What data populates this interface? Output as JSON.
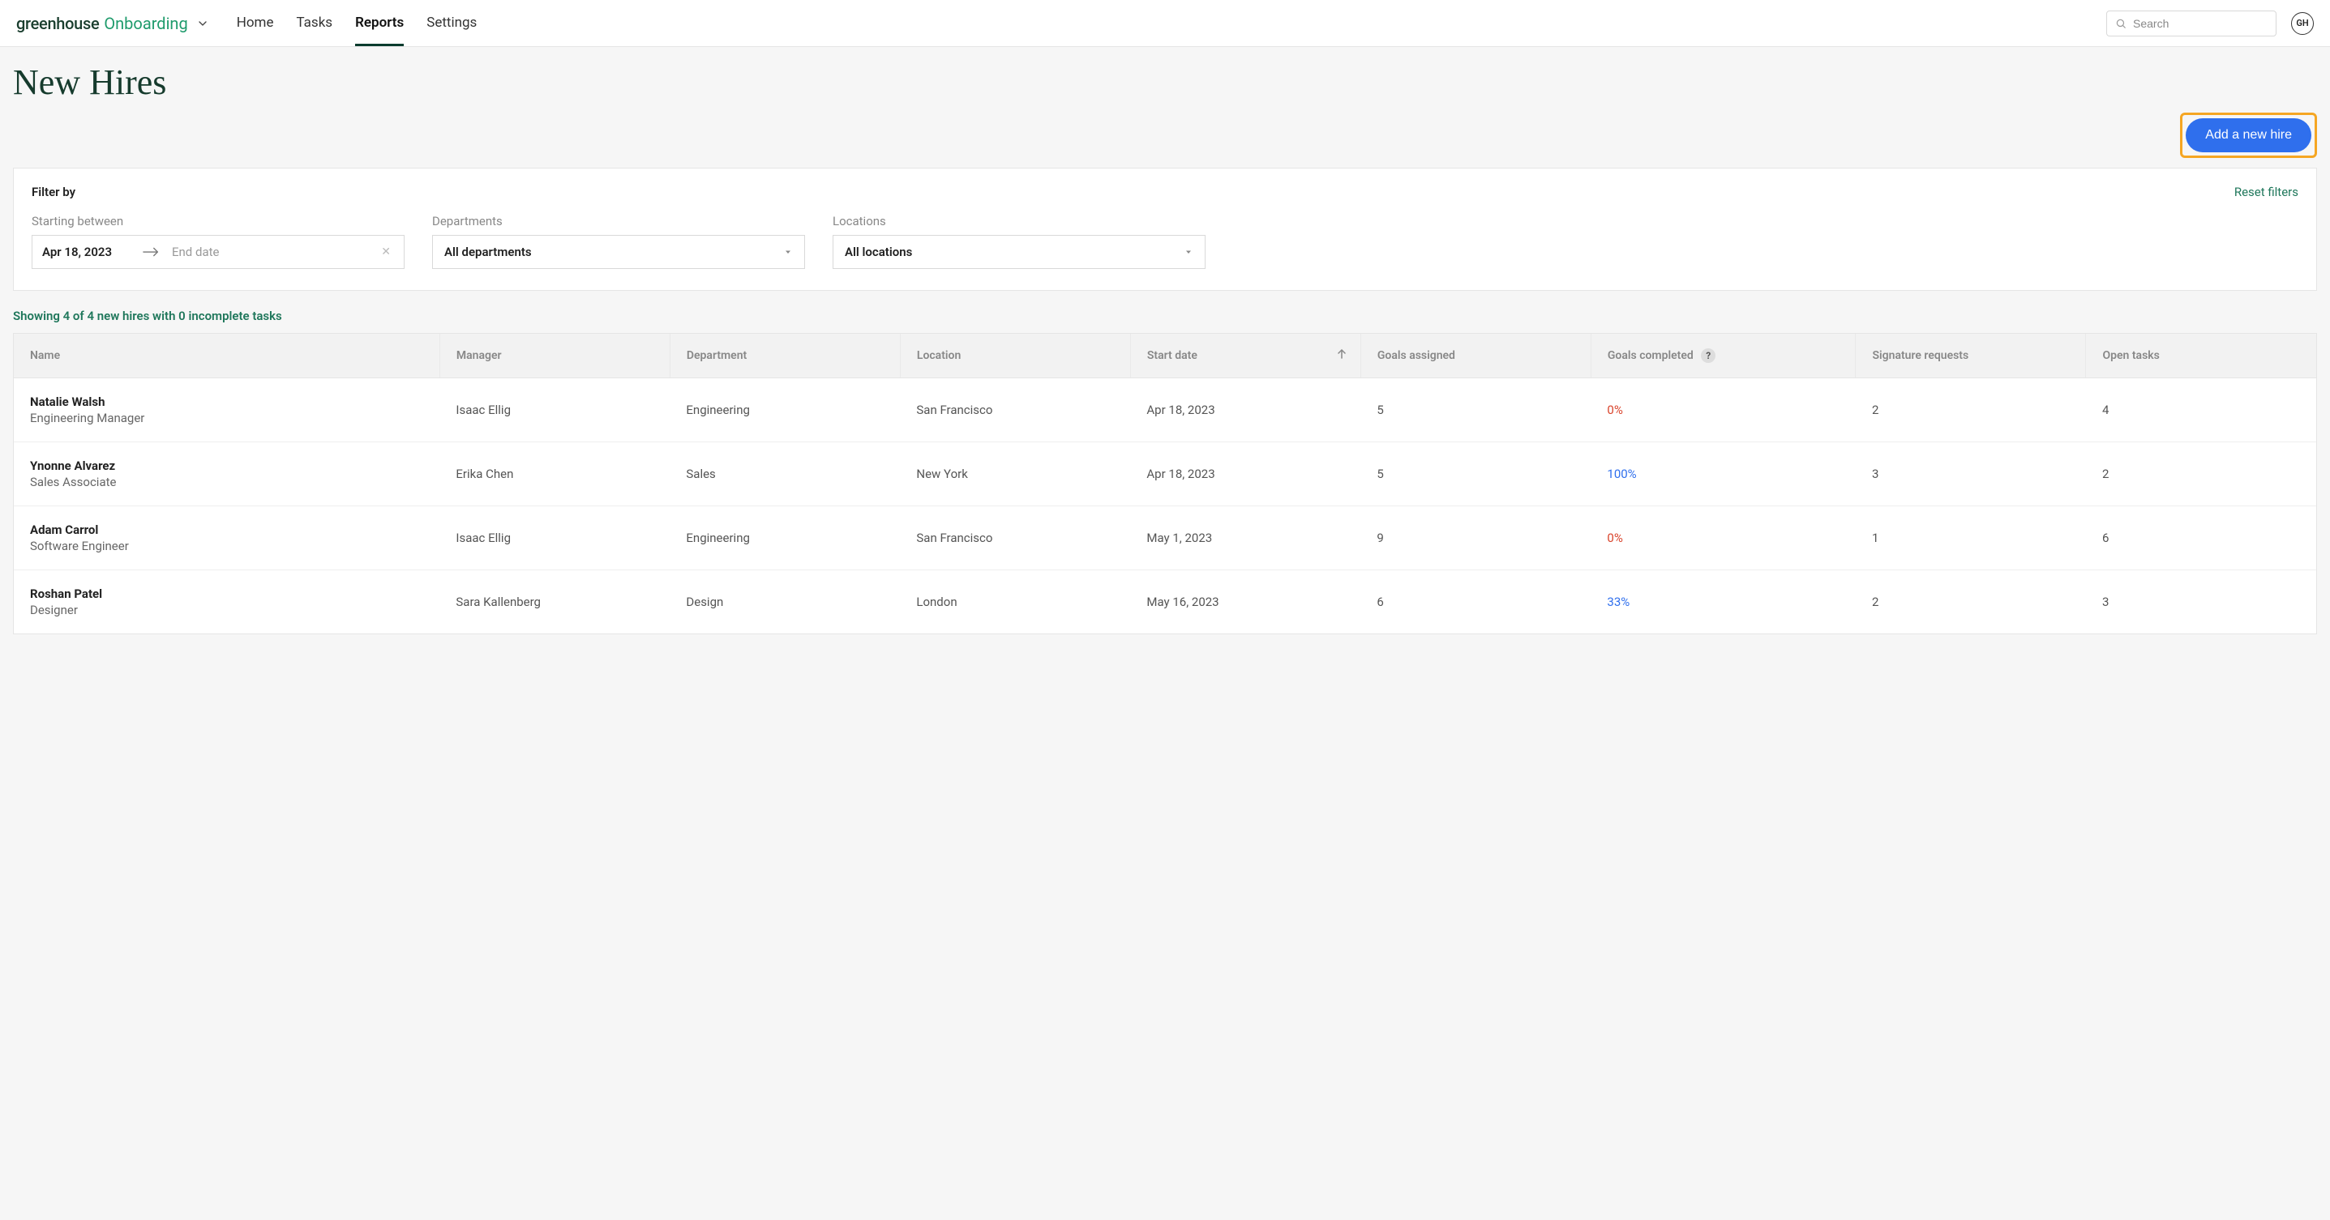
{
  "brand": {
    "main": "greenhouse",
    "sub": "Onboarding"
  },
  "nav": {
    "home": "Home",
    "tasks": "Tasks",
    "reports": "Reports",
    "settings": "Settings"
  },
  "search": {
    "placeholder": "Search"
  },
  "avatar": {
    "initials": "GH"
  },
  "page_title": "New Hires",
  "actions": {
    "add_new_hire": "Add a new hire"
  },
  "filter": {
    "label": "Filter by",
    "reset": "Reset filters",
    "starting_between_label": "Starting between",
    "start_date": "Apr 18, 2023",
    "end_date_placeholder": "End date",
    "departments_label": "Departments",
    "departments_value": "All departments",
    "locations_label": "Locations",
    "locations_value": "All locations"
  },
  "results_caption": "Showing 4 of 4 new hires  with 0 incomplete tasks",
  "table": {
    "headers": {
      "name": "Name",
      "manager": "Manager",
      "department": "Department",
      "location": "Location",
      "start_date": "Start date",
      "goals_assigned": "Goals assigned",
      "goals_completed": "Goals completed",
      "signature_requests": "Signature requests",
      "open_tasks": "Open tasks",
      "help": "?"
    },
    "rows": [
      {
        "name": "Natalie Walsh",
        "title": "Engineering Manager",
        "manager": "Isaac Ellig",
        "department": "Engineering",
        "location": "San Francisco",
        "start_date": "Apr 18, 2023",
        "goals_assigned": "5",
        "goals_completed": "0%",
        "goals_completed_class": "goal-red",
        "signature_requests": "2",
        "open_tasks": "4"
      },
      {
        "name": "Ynonne Alvarez",
        "title": "Sales Associate",
        "manager": "Erika Chen",
        "department": "Sales",
        "location": "New York",
        "start_date": "Apr 18, 2023",
        "goals_assigned": "5",
        "goals_completed": "100%",
        "goals_completed_class": "goal-blue",
        "signature_requests": "3",
        "open_tasks": "2"
      },
      {
        "name": "Adam Carrol",
        "title": "Software Engineer",
        "manager": "Isaac Ellig",
        "department": "Engineering",
        "location": "San Francisco",
        "start_date": "May 1, 2023",
        "goals_assigned": "9",
        "goals_completed": "0%",
        "goals_completed_class": "goal-red",
        "signature_requests": "1",
        "open_tasks": "6"
      },
      {
        "name": "Roshan Patel",
        "title": "Designer",
        "manager": "Sara Kallenberg",
        "department": "Design",
        "location": "London",
        "start_date": "May 16, 2023",
        "goals_assigned": "6",
        "goals_completed": "33%",
        "goals_completed_class": "goal-blue",
        "signature_requests": "2",
        "open_tasks": "3"
      }
    ]
  }
}
